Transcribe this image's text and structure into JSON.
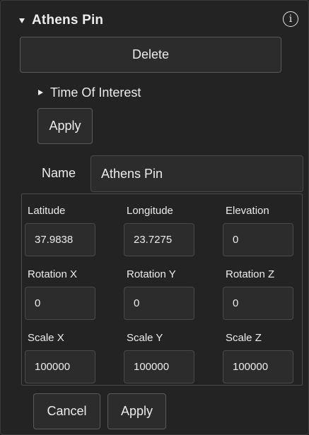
{
  "header": {
    "title": "Athens Pin",
    "info_glyph": "i",
    "expand_icon": "triangle-down-icon"
  },
  "actions": {
    "delete_label": "Delete"
  },
  "time_of_interest": {
    "label": "Time Of Interest",
    "collapsed_icon": "triangle-right-icon",
    "apply_label": "Apply"
  },
  "name": {
    "label": "Name",
    "value": "Athens Pin"
  },
  "fields": {
    "latitude": {
      "label": "Latitude",
      "value": "37.9838"
    },
    "longitude": {
      "label": "Longitude",
      "value": "23.7275"
    },
    "elevation": {
      "label": "Elevation",
      "value": "0"
    },
    "rotation_x": {
      "label": "Rotation X",
      "value": "0"
    },
    "rotation_y": {
      "label": "Rotation Y",
      "value": "0"
    },
    "rotation_z": {
      "label": "Rotation Z",
      "value": "0"
    },
    "scale_x": {
      "label": "Scale X",
      "value": "100000"
    },
    "scale_y": {
      "label": "Scale Y",
      "value": "100000"
    },
    "scale_z": {
      "label": "Scale Z",
      "value": "100000"
    }
  },
  "footer": {
    "cancel_label": "Cancel",
    "apply_label": "Apply"
  },
  "colors": {
    "background": "#232323",
    "control": "#2c2c2c",
    "border": "#5a5a5a",
    "text": "#ececec"
  }
}
